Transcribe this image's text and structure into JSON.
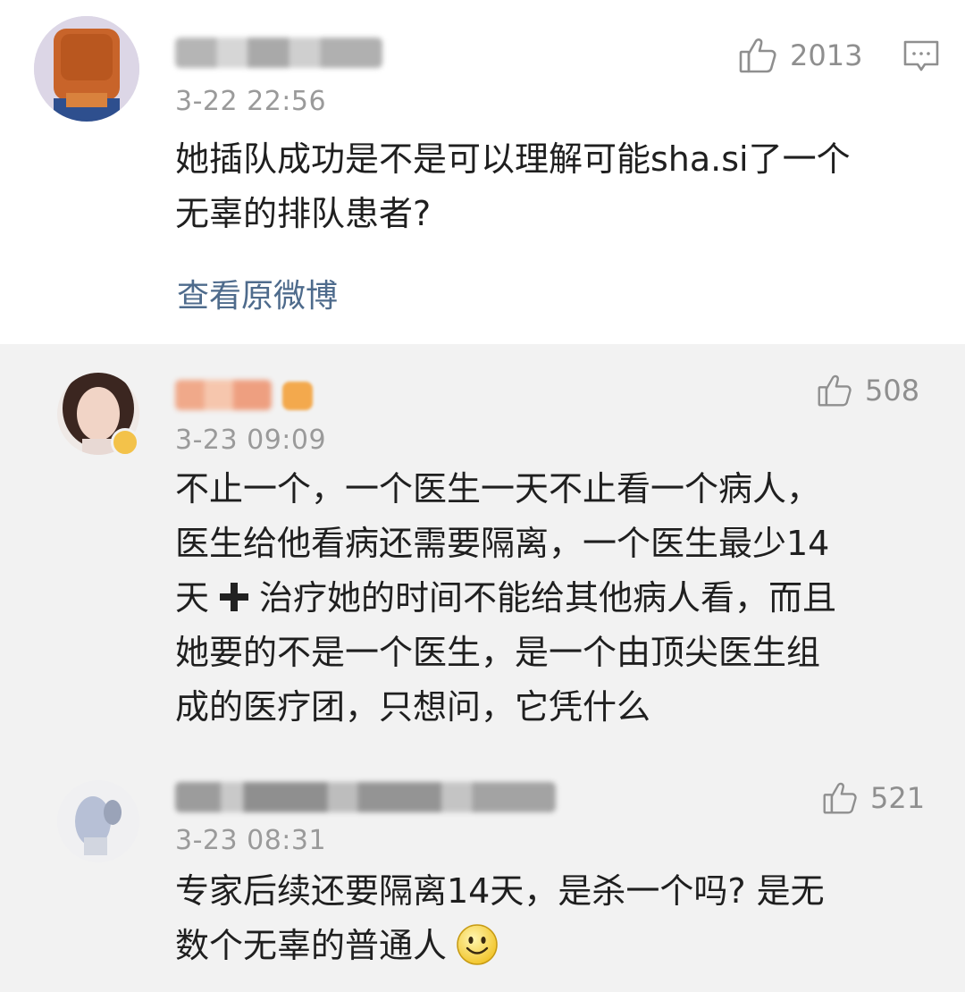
{
  "comments": [
    {
      "time": "3-22 22:56",
      "likes": "2013",
      "text": "她插队成功是不是可以理解可能sha.si了一个\n无辜的排队患者?",
      "view_original": "查看原微博"
    }
  ],
  "replies": [
    {
      "time": "3-23 09:09",
      "likes": "508",
      "text_before": "不止一个，一个医生一天不止看一个病人，\n医生给他看病还需要隔离，一个医生最少14\n天",
      "text_after": "治疗她的时间不能给其他病人看，而且\n她要的不是一个医生，是一个由顶尖医生组\n成的医疗团，只想问，它凭什么"
    },
    {
      "time": "3-23 08:31",
      "likes": "521",
      "text": "专家后续还要隔离14天，是杀一个吗? 是无\n数个无辜的普通人"
    }
  ],
  "colors": {
    "reply_bg": "#f2f2f2",
    "link": "#4e6b8c",
    "muted": "#9a9a9a"
  },
  "icons": [
    "thumbs-up-icon",
    "comment-icon",
    "plus-icon",
    "smiley-emoji"
  ]
}
